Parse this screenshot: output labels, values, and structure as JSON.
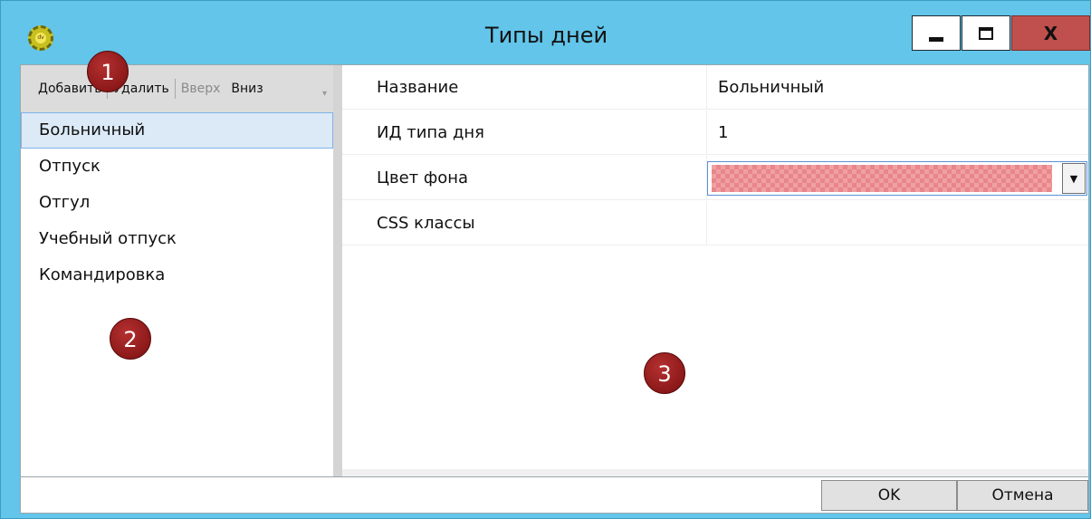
{
  "window": {
    "title": "Типы дней",
    "icon": "app-gear-icon",
    "icon_text": "dv",
    "min_glyph": "minimize-icon",
    "max_glyph": "maximize-icon",
    "close_label": "X"
  },
  "toolbar": {
    "add_label": "Добавить",
    "delete_label": "Удалить",
    "up_label": "Вверх",
    "down_label": "Вниз"
  },
  "list": {
    "items": [
      "Больничный",
      "Отпуск",
      "Отгул",
      "Учебный отпуск",
      "Командировка"
    ],
    "selected_index": 0
  },
  "properties": [
    {
      "name": "Название",
      "value": "Больничный"
    },
    {
      "name": "ИД типа дня",
      "value": "1"
    },
    {
      "name": "Цвет фона",
      "value": ""
    },
    {
      "name": "CSS классы",
      "value": ""
    }
  ],
  "background_color": "#f0a0a3",
  "footer": {
    "ok_label": "OK",
    "cancel_label": "Отмена"
  },
  "badges": [
    "1",
    "2",
    "3"
  ],
  "colors": {
    "titlebar": "#62c5e9",
    "close_button": "#c0504d",
    "selection": "#dceaf7",
    "badge": "#8b1a1a"
  }
}
